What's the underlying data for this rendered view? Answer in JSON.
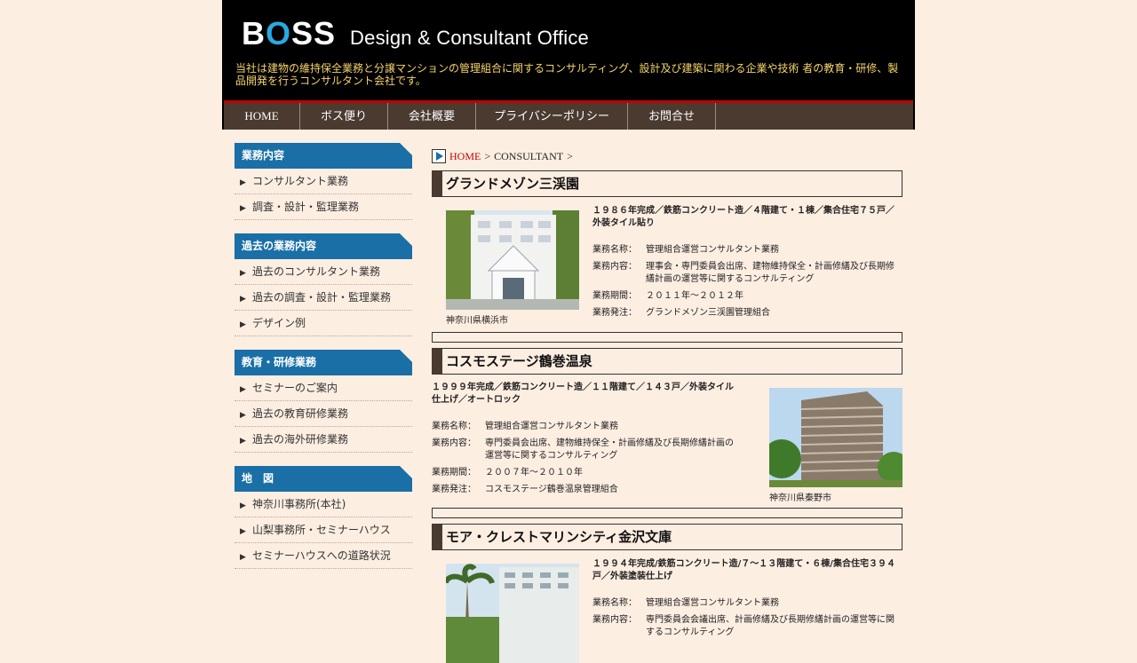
{
  "header": {
    "logo_text": "BOSS",
    "site_subtitle": "Design & Consultant Office",
    "tagline": "当社は建物の維持保全業務と分譲マンションの管理組合に関するコンサルティング、設計及び建築に関わる企業や技術 者の教育・研修、製品開発を行うコンサルタント会社です。"
  },
  "nav": [
    {
      "label": "HOME"
    },
    {
      "label": "ボス便り"
    },
    {
      "label": "会社概要"
    },
    {
      "label": "プライバシーポリシー"
    },
    {
      "label": "お問合せ"
    }
  ],
  "sidebar": [
    {
      "heading": "業務内容",
      "items": [
        "コンサルタント業務",
        "調査・設計・監理業務"
      ]
    },
    {
      "heading": "過去の業務内容",
      "items": [
        "過去のコンサルタント業務",
        "過去の調査・設計・監理業務",
        "デザイン例"
      ]
    },
    {
      "heading": "教育・研修業務",
      "items": [
        "セミナーのご案内",
        "過去の教育研修業務",
        "過去の海外研修業務"
      ]
    },
    {
      "heading": "地　図",
      "items": [
        "神奈川事務所(本社)",
        "山梨事務所・セミナーハウス",
        "セミナーハウスへの道路状況"
      ]
    }
  ],
  "breadcrumb": {
    "home": "HOME",
    "sep1": ">",
    "current": "CONSULTANT",
    "sep2": ">"
  },
  "projects": [
    {
      "title": "グランドメゾン三渓園",
      "lead": "１９８６年完成／鉄筋コンクリート造／４階建て・１棟／集合住宅７５戸／外装タイル貼り",
      "rows": [
        {
          "k": "業務名称：",
          "v": "管理組合運営コンサルタント業務"
        },
        {
          "k": "業務内容：",
          "v": "理事会・専門委員会出席、建物維持保全・計画修繕及び長期修繕計画の運営等に関するコンサルティング"
        },
        {
          "k": "業務期間：",
          "v": "２０１１年～２０１２年"
        },
        {
          "k": "業務発注：",
          "v": "グランドメゾン三渓園管理組合"
        }
      ],
      "caption": "神奈川県横浜市"
    },
    {
      "title": "コスモステージ鶴巻温泉",
      "lead": "１９９９年完成／鉄筋コンクリート造／１１階建て／１４３戸／外装タイル仕上げ／オートロック",
      "rows": [
        {
          "k": "業務名称：",
          "v": "管理組合運営コンサルタント業務"
        },
        {
          "k": "業務内容：",
          "v": "専門委員会出席、建物維持保全・計画修繕及び長期修繕計画の運営等に関するコンサルティング"
        },
        {
          "k": "業務期間：",
          "v": "２００７年～２０１０年"
        },
        {
          "k": "業務発注：",
          "v": "コスモステージ鶴巻温泉管理組合"
        }
      ],
      "caption": "神奈川県秦野市"
    },
    {
      "title": "モア・クレストマリンシティ金沢文庫",
      "lead": "１９９４年完成/鉄筋コンクリート造/７～１３階建て・６棟/集合住宅３９４戸／外装塗装仕上げ",
      "rows": [
        {
          "k": "業務名称：",
          "v": "管理組合運営コンサルタント業務"
        },
        {
          "k": "業務内容：",
          "v": "専門委員会会議出席、計画修繕及び長期修繕計画の運営等に関するコンサルティング"
        }
      ],
      "caption": ""
    }
  ],
  "colors": {
    "header_bg": "#000000",
    "nav_bg": "#4a3a30",
    "nav_accent": "#c00000",
    "sidebar_head": "#1a6fa6",
    "page_bg": "#fdeee2",
    "tagline": "#f5d46a"
  }
}
